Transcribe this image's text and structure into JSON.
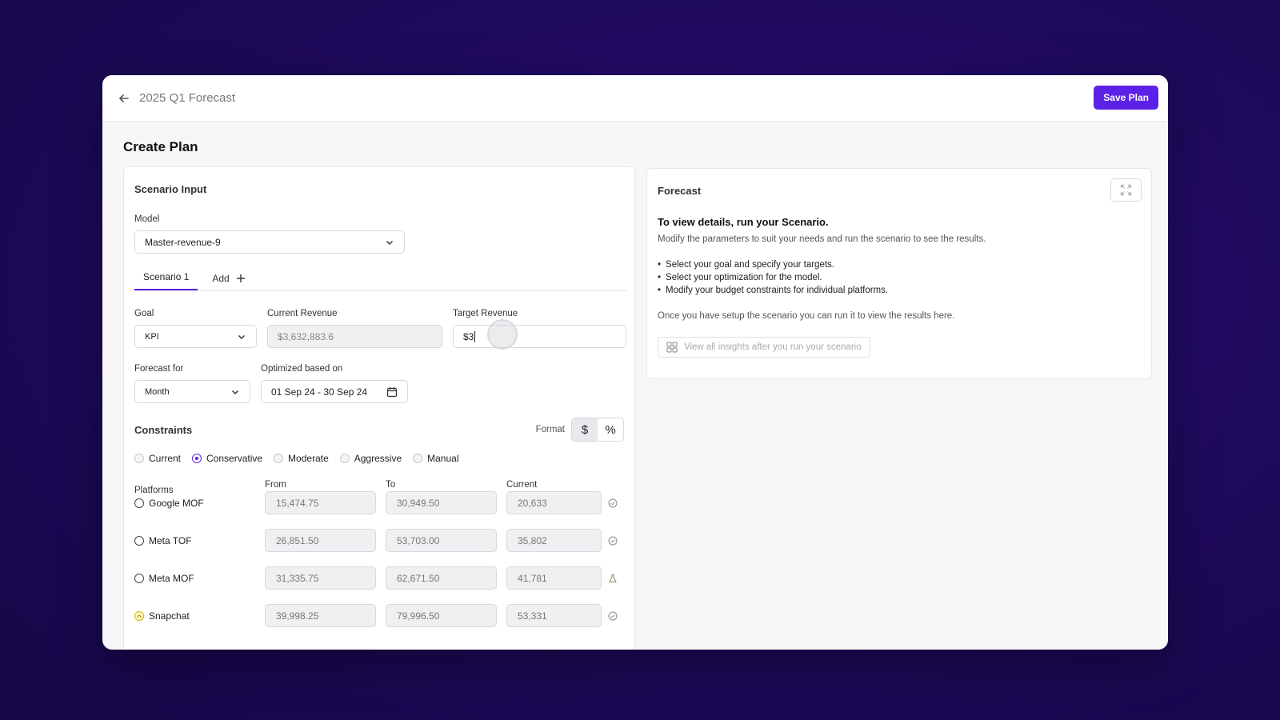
{
  "topbar": {
    "title": "2025 Q1 Forecast",
    "save_label": "Save Plan"
  },
  "page": {
    "title": "Create Plan"
  },
  "scenario_input": {
    "title": "Scenario Input",
    "model_label": "Model",
    "model_value": "Master-revenue-9",
    "tabs": [
      {
        "label": "Scenario 1",
        "active": true
      },
      {
        "label": "Add",
        "active": false
      }
    ],
    "goal_label": "Goal",
    "goal_value": "KPI",
    "current_revenue_label": "Current Revenue",
    "current_revenue_value": "$3,632,883.6",
    "target_revenue_label": "Target Revenue",
    "target_revenue_value": "$3",
    "forecast_for_label": "Forecast for",
    "forecast_for_value": "Month",
    "optimized_label": "Optimized based on",
    "optimized_value": "01 Sep 24 - 30 Sep 24"
  },
  "constraints": {
    "title": "Constraints",
    "format_label": "Format",
    "format_options": [
      "$",
      "%"
    ],
    "format_selected": "$",
    "options": [
      "Current",
      "Conservative",
      "Moderate",
      "Aggressive",
      "Manual"
    ],
    "selected": "Conservative",
    "columns": {
      "platforms": "Platforms",
      "from": "From",
      "to": "To",
      "current": "Current"
    },
    "rows": [
      {
        "name": "Google MOF",
        "from": "15,474.75",
        "to": "30,949.50",
        "current": "20,633",
        "icon": "check-circle-icon"
      },
      {
        "name": "Meta TOF",
        "from": "26,851.50",
        "to": "53,703.00",
        "current": "35,802",
        "icon": "check-circle-icon"
      },
      {
        "name": "Meta MOF",
        "from": "31,335.75",
        "to": "62,671.50",
        "current": "41,781",
        "icon": "flask-icon"
      },
      {
        "name": "Snapchat",
        "from": "39,998.25",
        "to": "79,996.50",
        "current": "53,331",
        "icon": "check-circle-icon"
      }
    ]
  },
  "forecast": {
    "title": "Forecast",
    "heading": "To view details, run your Scenario.",
    "subtext": "Modify the parameters to suit your needs and run the scenario to see the results.",
    "bullets": [
      "Select your goal and specify your targets.",
      "Select your optimization for the model.",
      "Modify your budget constraints for individual platforms."
    ],
    "note": "Once you have setup the scenario you can run it to view the results here.",
    "insights_label": "View all insights after you run your scenario"
  },
  "colors": {
    "accent": "#5b21e6",
    "background": "#1f0a5e"
  }
}
